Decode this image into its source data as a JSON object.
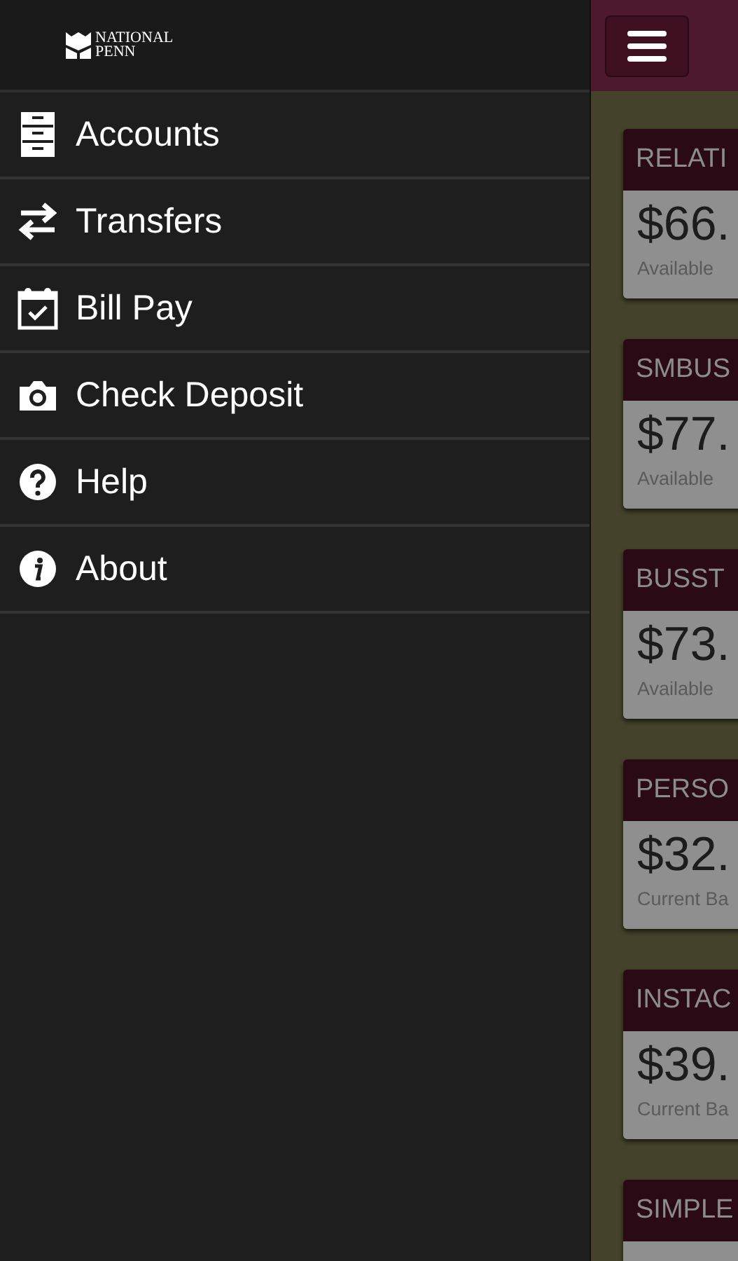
{
  "drawer": {
    "logo": {
      "line_1": "NATIONAL",
      "line_2": "PENN"
    },
    "items": [
      {
        "label": "Accounts",
        "kind": "cabinet"
      },
      {
        "label": "Transfers",
        "kind": "arrows"
      },
      {
        "label": "Bill Pay",
        "kind": "calendar"
      },
      {
        "label": "Check Deposit",
        "kind": "camera"
      },
      {
        "label": "Help",
        "kind": "help"
      },
      {
        "label": "About",
        "kind": "info"
      }
    ]
  },
  "accounts": [
    {
      "name": "RELATI",
      "amount": "$66.",
      "caption": "Available"
    },
    {
      "name": "SMBUS",
      "amount": "$77.",
      "caption": "Available"
    },
    {
      "name": "BUSST",
      "amount": "$73.",
      "caption": "Available"
    },
    {
      "name": "PERSO",
      "amount": "$32.",
      "caption": "Current Ba"
    },
    {
      "name": "INSTAC",
      "amount": "$39.",
      "caption": "Current Ba"
    },
    {
      "name": "SIMPLE"
    }
  ]
}
